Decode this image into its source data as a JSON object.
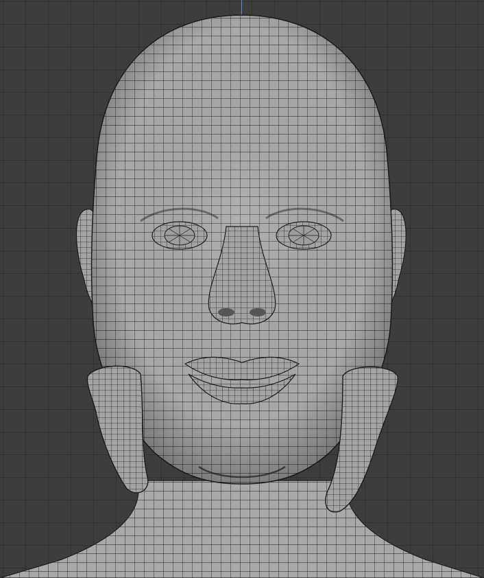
{
  "viewport": {
    "type": "3d-viewport",
    "mode": "wireframe-overlay",
    "object": "head-mesh",
    "colors": {
      "background": "#3d3d3d",
      "grid_line": "#333333",
      "mesh_fill": "#a7a7a7",
      "mesh_wire": "#1c1c1c",
      "axis_z": "#5a8fd6"
    }
  }
}
